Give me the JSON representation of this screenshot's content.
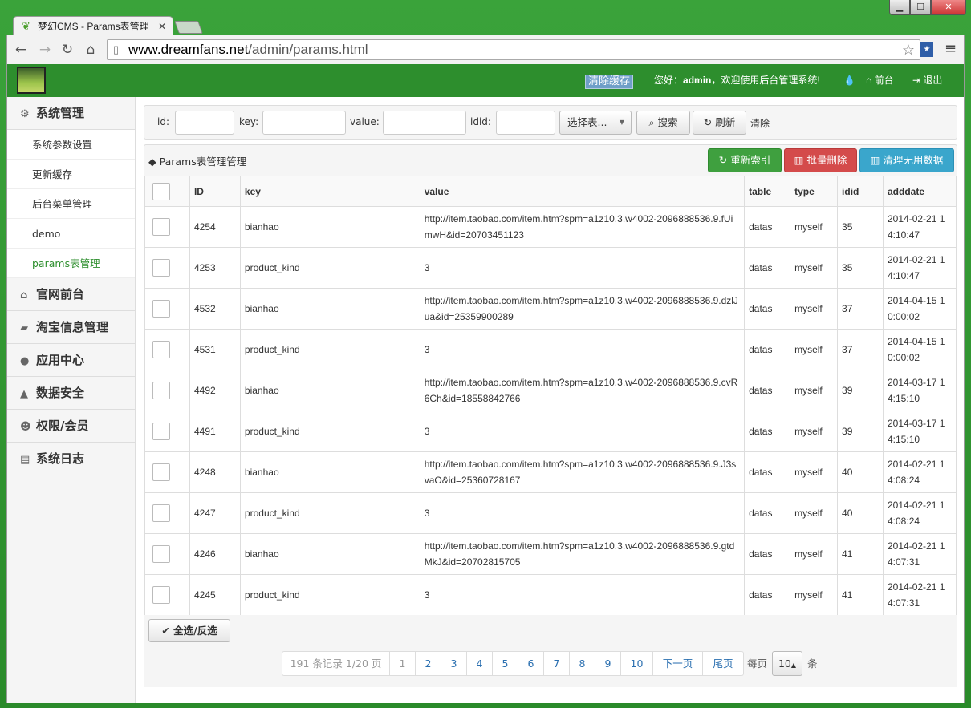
{
  "browser": {
    "tab_title": "梦幻CMS - Params表管理",
    "url_host": "www.dreamfans.net",
    "url_path": "/admin/params.html"
  },
  "topnav": {
    "clear_cache": "清除缓存",
    "greeting": "您好：",
    "username": "admin",
    "welcome": "，欢迎使用后台管理系统!",
    "front_label": "前台",
    "logout_label": "退出"
  },
  "sidebar": {
    "section_label": "系统管理",
    "sub_items": [
      "系统参数设置",
      "更新缓存",
      "后台菜单管理",
      "demo",
      "params表管理"
    ],
    "groups": [
      "官网前台",
      "淘宝信息管理",
      "应用中心",
      "数据安全",
      "权限/会员",
      "系统日志"
    ]
  },
  "search": {
    "id_label": "id:",
    "key_label": "key:",
    "value_label": "value:",
    "idid_label": "idid:",
    "table_select": "选择表...",
    "search_btn": "搜索",
    "refresh_btn": "刷新",
    "clear_link": "清除"
  },
  "panel": {
    "title": "◆ Params表管理管理",
    "reindex_btn": "重新索引",
    "batch_delete_btn": "批量删除",
    "cleanup_btn": "清理无用数据"
  },
  "table": {
    "columns": [
      "ID",
      "key",
      "value",
      "table",
      "type",
      "idid",
      "adddate"
    ],
    "rows": [
      {
        "id": "4254",
        "key": "bianhao",
        "value": "http://item.taobao.com/item.htm?spm=a1z10.3.w4002-2096888536.9.fUimwH&id=20703451123",
        "table": "datas",
        "type": "myself",
        "idid": "35",
        "adddate": "2014-02-21 14:10:47"
      },
      {
        "id": "4253",
        "key": "product_kind",
        "value": "3",
        "table": "datas",
        "type": "myself",
        "idid": "35",
        "adddate": "2014-02-21 14:10:47"
      },
      {
        "id": "4532",
        "key": "bianhao",
        "value": "http://item.taobao.com/item.htm?spm=a1z10.3.w4002-2096888536.9.dzlJua&id=25359900289",
        "table": "datas",
        "type": "myself",
        "idid": "37",
        "adddate": "2014-04-15 10:00:02"
      },
      {
        "id": "4531",
        "key": "product_kind",
        "value": "3",
        "table": "datas",
        "type": "myself",
        "idid": "37",
        "adddate": "2014-04-15 10:00:02"
      },
      {
        "id": "4492",
        "key": "bianhao",
        "value": "http://item.taobao.com/item.htm?spm=a1z10.3.w4002-2096888536.9.cvR6Ch&id=18558842766",
        "table": "datas",
        "type": "myself",
        "idid": "39",
        "adddate": "2014-03-17 14:15:10"
      },
      {
        "id": "4491",
        "key": "product_kind",
        "value": "3",
        "table": "datas",
        "type": "myself",
        "idid": "39",
        "adddate": "2014-03-17 14:15:10"
      },
      {
        "id": "4248",
        "key": "bianhao",
        "value": "http://item.taobao.com/item.htm?spm=a1z10.3.w4002-2096888536.9.J3svaO&id=25360728167",
        "table": "datas",
        "type": "myself",
        "idid": "40",
        "adddate": "2014-02-21 14:08:24"
      },
      {
        "id": "4247",
        "key": "product_kind",
        "value": "3",
        "table": "datas",
        "type": "myself",
        "idid": "40",
        "adddate": "2014-02-21 14:08:24"
      },
      {
        "id": "4246",
        "key": "bianhao",
        "value": "http://item.taobao.com/item.htm?spm=a1z10.3.w4002-2096888536.9.gtdMkJ&id=20702815705",
        "table": "datas",
        "type": "myself",
        "idid": "41",
        "adddate": "2014-02-21 14:07:31"
      },
      {
        "id": "4245",
        "key": "product_kind",
        "value": "3",
        "table": "datas",
        "type": "myself",
        "idid": "41",
        "adddate": "2014-02-21 14:07:31"
      }
    ]
  },
  "footer": {
    "select_all_btn": "全选/反选",
    "record_info": "191 条记录 1/20 页",
    "pages": [
      "1",
      "2",
      "3",
      "4",
      "5",
      "6",
      "7",
      "8",
      "9",
      "10"
    ],
    "next_label": "下一页",
    "last_label": "尾页",
    "per_page_label": "每页",
    "per_page_value": "10",
    "per_page_unit": "条"
  }
}
